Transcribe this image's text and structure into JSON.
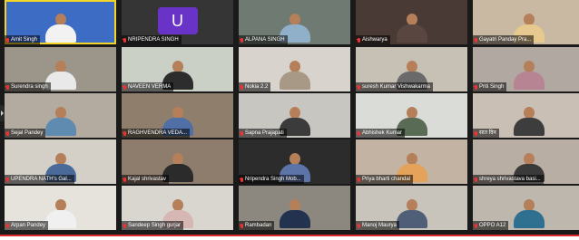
{
  "meeting": {
    "participants": [
      {
        "name": "Amit Singh",
        "bg": "#3d6cc4",
        "body": "#f2f2f2",
        "active": true,
        "avatar": false
      },
      {
        "name": "NRIPENDRA SINGH",
        "bg": "#353535",
        "body": "",
        "active": false,
        "avatar": true,
        "avatar_letter": "U",
        "avatar_color": "#6a33c8"
      },
      {
        "name": "ALPANA SINGH",
        "bg": "#6f7a72",
        "body": "#8fb0c8",
        "active": false,
        "avatar": false
      },
      {
        "name": "Aishwarya",
        "bg": "#4a3a35",
        "body": "#5a4640",
        "active": false,
        "avatar": false
      },
      {
        "name": "Gayatri Panday Pra...",
        "bg": "#c9b9a3",
        "body": "#e7c98f",
        "active": false,
        "avatar": false
      },
      {
        "name": "Surendra singh",
        "bg": "#9c968a",
        "body": "#e9e9e9",
        "active": false,
        "avatar": false
      },
      {
        "name": "NAVEEN VERMA",
        "bg": "#cbd0c7",
        "body": "#2d2d2d",
        "active": false,
        "avatar": false
      },
      {
        "name": "Nokia 2.2",
        "bg": "#d8d3cc",
        "body": "#a89886",
        "active": false,
        "avatar": false
      },
      {
        "name": "suresh Kumar Vishwakarma",
        "bg": "#c7c0b5",
        "body": "#6a6a6a",
        "active": false,
        "avatar": false
      },
      {
        "name": "Priti Singh",
        "bg": "#b2a8a2",
        "body": "#b78494",
        "active": false,
        "avatar": false
      },
      {
        "name": "Sejal Pandey",
        "bg": "#b3ab9f",
        "body": "#5f8bb0",
        "active": false,
        "avatar": false
      },
      {
        "name": "RAGHVENDRA VEDA...",
        "bg": "#8f7e6b",
        "body": "#4f6fa6",
        "active": false,
        "avatar": false
      },
      {
        "name": "Sapna Prajapati",
        "bg": "#c8c6c0",
        "body": "#3b3b3b",
        "active": false,
        "avatar": false
      },
      {
        "name": "Abhishek Kumar",
        "bg": "#dadcd8",
        "body": "#5a6b55",
        "active": false,
        "avatar": false
      },
      {
        "name": "सात दिन",
        "bg": "#c9bfb4",
        "body": "#3d3d3d",
        "active": false,
        "avatar": false
      },
      {
        "name": "UPENDRA NATH's Gal...",
        "bg": "#d4d0c8",
        "body": "#4a6b9a",
        "active": false,
        "avatar": false
      },
      {
        "name": "Kajal shrivastav",
        "bg": "#8e7d6c",
        "body": "#2b2b2b",
        "active": false,
        "avatar": false
      },
      {
        "name": "Nripendra Singh Mob...",
        "bg": "#2c2c2c",
        "body": "#5d74a8",
        "active": false,
        "avatar": false
      },
      {
        "name": "Priya bharti chandal",
        "bg": "#c2b3a2",
        "body": "#e4a25a",
        "active": false,
        "avatar": false
      },
      {
        "name": "shreya shrivastava basi...",
        "bg": "#b8aea4",
        "body": "#3a3a3a",
        "active": false,
        "avatar": false
      },
      {
        "name": "Arpan Pandey",
        "bg": "#e6e3dd",
        "body": "#f0f0f0",
        "active": false,
        "avatar": false
      },
      {
        "name": "Sandeep Singh gurjar",
        "bg": "#d9d6d0",
        "body": "#d7b7b4",
        "active": false,
        "avatar": false
      },
      {
        "name": "Rambadan",
        "bg": "#8c8880",
        "body": "#23324f",
        "active": false,
        "avatar": false
      },
      {
        "name": "Manoj Maurya",
        "bg": "#c9c4bb",
        "body": "#4f5f78",
        "active": false,
        "avatar": false
      },
      {
        "name": "OPPO A12",
        "bg": "#bdb7ae",
        "body": "#2f6f8f",
        "active": false,
        "avatar": false
      }
    ]
  }
}
